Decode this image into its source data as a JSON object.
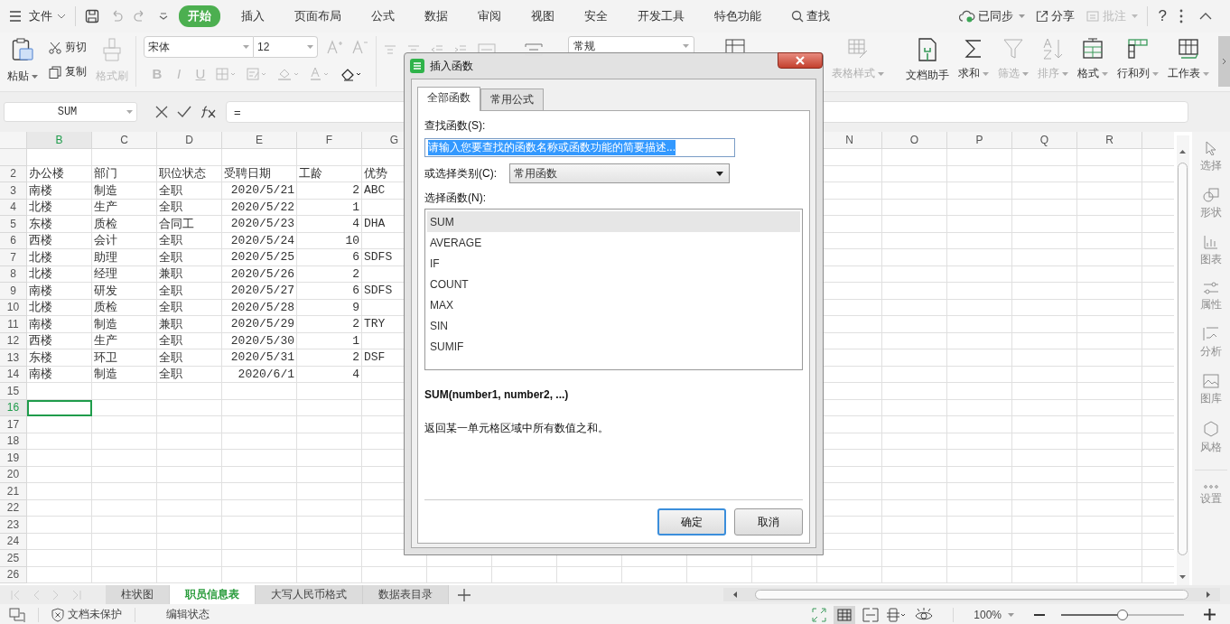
{
  "menu_bar": {
    "file": "文件",
    "tabs": [
      {
        "label": "开始",
        "selected": true
      },
      {
        "label": "插入",
        "selected": false
      },
      {
        "label": "页面布局",
        "selected": false
      },
      {
        "label": "公式",
        "selected": false
      },
      {
        "label": "数据",
        "selected": false
      },
      {
        "label": "审阅",
        "selected": false
      },
      {
        "label": "视图",
        "selected": false
      },
      {
        "label": "安全",
        "selected": false
      },
      {
        "label": "开发工具",
        "selected": false
      },
      {
        "label": "特色功能",
        "selected": false
      }
    ],
    "search": "查找",
    "sync": "已同步",
    "share": "分享",
    "comment": {
      "label": "批注",
      "disabled": true
    },
    "help": "?"
  },
  "ribbon": {
    "paste": "粘贴",
    "cut": "剪切",
    "copy": "复制",
    "format_painter": {
      "label": "格式刷",
      "disabled": true
    },
    "font": "宋体",
    "size": "12",
    "format_glyphs": [
      {
        "glyph": "B",
        "disabled": true
      },
      {
        "glyph": "I",
        "disabled": true
      },
      {
        "glyph": "U",
        "disabled": true
      }
    ],
    "number_format": "常规",
    "tools": [
      {
        "kind": "table-style",
        "label": "表格样式",
        "disabled": true
      },
      {
        "kind": "assistant",
        "label": "文档助手",
        "disabled": false
      },
      {
        "kind": "sum",
        "label": "求和",
        "disabled": false
      },
      {
        "kind": "filter",
        "label": "筛选",
        "disabled": true
      },
      {
        "kind": "sort",
        "label": "排序",
        "disabled": true
      },
      {
        "kind": "format",
        "label": "格式",
        "disabled": false
      },
      {
        "kind": "rowcol",
        "label": "行和列",
        "disabled": false
      },
      {
        "kind": "sheet",
        "label": "工作表",
        "disabled": false
      }
    ]
  },
  "formula_bar": {
    "name_box": "SUM",
    "value": "="
  },
  "sheet": {
    "columns_left": [
      {
        "label": "B",
        "kind": "text",
        "selected": true
      },
      {
        "label": "C",
        "kind": "text",
        "selected": false
      },
      {
        "label": "D",
        "kind": "text",
        "selected": false
      },
      {
        "label": "E",
        "kind": "number",
        "selected": false
      },
      {
        "label": "F",
        "kind": "number",
        "selected": false
      },
      {
        "label": "G",
        "kind": "text",
        "selected": false
      }
    ],
    "columns_right": [
      {
        "label": "N"
      },
      {
        "label": "O"
      },
      {
        "label": "P"
      },
      {
        "label": "Q"
      },
      {
        "label": "R"
      }
    ],
    "rows": [
      {
        "label": "2",
        "kind": "header",
        "selected": false,
        "cells": [
          "办公楼",
          "部门",
          "职位状态",
          "受聘日期",
          "工龄",
          "优势"
        ]
      },
      {
        "label": "3",
        "kind": "data",
        "selected": false,
        "cells": [
          "南楼",
          "制造",
          "全职",
          "2020/5/21",
          "2",
          "ABC"
        ]
      },
      {
        "label": "4",
        "kind": "data",
        "selected": false,
        "cells": [
          "北楼",
          "生产",
          "全职",
          "2020/5/22",
          "1"
        ]
      },
      {
        "label": "5",
        "kind": "data",
        "selected": false,
        "cells": [
          "东楼",
          "质检",
          "合同工",
          "2020/5/23",
          "4",
          "DHA"
        ]
      },
      {
        "label": "6",
        "kind": "data",
        "selected": false,
        "cells": [
          "西楼",
          "会计",
          "全职",
          "2020/5/24",
          "10"
        ]
      },
      {
        "label": "7",
        "kind": "data",
        "selected": false,
        "cells": [
          "北楼",
          "助理",
          "全职",
          "2020/5/25",
          "6",
          "SDFS"
        ]
      },
      {
        "label": "8",
        "kind": "data",
        "selected": false,
        "cells": [
          "北楼",
          "经理",
          "兼职",
          "2020/5/26",
          "2"
        ]
      },
      {
        "label": "9",
        "kind": "data",
        "selected": false,
        "cells": [
          "南楼",
          "研发",
          "全职",
          "2020/5/27",
          "6",
          "SDFS"
        ]
      },
      {
        "label": "10",
        "kind": "data",
        "selected": false,
        "cells": [
          "北楼",
          "质检",
          "全职",
          "2020/5/28",
          "9"
        ]
      },
      {
        "label": "11",
        "kind": "data",
        "selected": false,
        "cells": [
          "南楼",
          "制造",
          "兼职",
          "2020/5/29",
          "2",
          "TRY"
        ]
      },
      {
        "label": "12",
        "kind": "data",
        "selected": false,
        "cells": [
          "西楼",
          "生产",
          "全职",
          "2020/5/30",
          "1"
        ]
      },
      {
        "label": "13",
        "kind": "data",
        "selected": false,
        "cells": [
          "东楼",
          "环卫",
          "全职",
          "2020/5/31",
          "2",
          "DSF"
        ]
      },
      {
        "label": "14",
        "kind": "data",
        "selected": false,
        "cells": [
          "南楼",
          "制造",
          "全职",
          "2020/6/1",
          "4"
        ]
      },
      {
        "label": "15",
        "kind": "empty",
        "selected": false
      },
      {
        "label": "16",
        "kind": "empty",
        "selected": true
      },
      {
        "label": "17",
        "kind": "empty",
        "selected": false
      },
      {
        "label": "18",
        "kind": "empty",
        "selected": false
      },
      {
        "label": "19",
        "kind": "empty",
        "selected": false
      },
      {
        "label": "20",
        "kind": "empty",
        "selected": false
      },
      {
        "label": "21",
        "kind": "empty",
        "selected": false
      },
      {
        "label": "22",
        "kind": "empty",
        "selected": false
      },
      {
        "label": "23",
        "kind": "empty",
        "selected": false
      },
      {
        "label": "24",
        "kind": "empty",
        "selected": false
      },
      {
        "label": "25",
        "kind": "empty",
        "selected": false
      },
      {
        "label": "26",
        "kind": "empty",
        "selected": false
      }
    ]
  },
  "side_panel": [
    {
      "kind": "select",
      "label": "选择",
      "disabled": true
    },
    {
      "kind": "shape",
      "label": "形状",
      "disabled": true
    },
    {
      "kind": "chart",
      "label": "图表",
      "disabled": true
    },
    {
      "kind": "props",
      "label": "属性",
      "disabled": true
    },
    {
      "kind": "analyze",
      "label": "分析",
      "disabled": true
    },
    {
      "kind": "gallery",
      "label": "图库",
      "disabled": true
    },
    {
      "kind": "style",
      "label": "风格",
      "disabled": true
    },
    {
      "kind": "settings",
      "label": "设置",
      "disabled": true
    }
  ],
  "sheet_tabs": [
    {
      "label": "柱状图",
      "selected": false
    },
    {
      "label": "职员信息表",
      "selected": true
    },
    {
      "label": "大写人民币格式",
      "selected": false
    },
    {
      "label": "数据表目录",
      "selected": false
    }
  ],
  "status_bar": {
    "protection": "文档未保护",
    "mode": "编辑状态",
    "zoom": "100%",
    "zoom_slider": {
      "level": 0.5
    }
  },
  "dialog": {
    "title": "插入函数",
    "tabs": [
      {
        "label": "全部函数",
        "selected": true
      },
      {
        "label": "常用公式",
        "selected": false
      }
    ],
    "search_label": "查找函数(S):",
    "search_value": "请输入您要查找的函数名称或函数功能的简要描述...",
    "category_label": "或选择类别(C):",
    "category": "常用函数",
    "list_label": "选择函数(N):",
    "functions": [
      {
        "name": "SUM",
        "selected": true
      },
      {
        "name": "AVERAGE",
        "selected": false
      },
      {
        "name": "IF",
        "selected": false
      },
      {
        "name": "COUNT",
        "selected": false
      },
      {
        "name": "MAX",
        "selected": false
      },
      {
        "name": "SIN",
        "selected": false
      },
      {
        "name": "SUMIF",
        "selected": false
      }
    ],
    "signature": "SUM(number1, number2, ...)",
    "description": "返回某一单元格区域中所有数值之和。",
    "buttons": [
      {
        "label": "确定",
        "default": true
      },
      {
        "label": "取消",
        "default": false
      }
    ]
  }
}
